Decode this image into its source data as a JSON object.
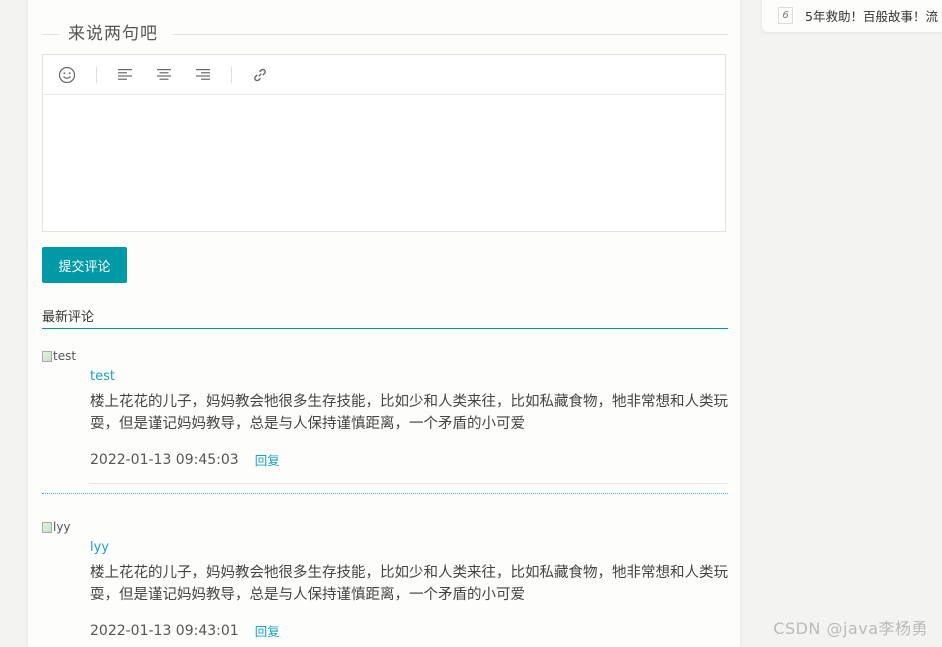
{
  "comment_form": {
    "section_title": "来说两句吧",
    "submit_label": "提交评论"
  },
  "toolbar": {
    "tools": [
      "emoji-icon",
      "align-left-icon",
      "align-center-icon",
      "align-right-icon",
      "link-icon"
    ]
  },
  "latest": {
    "title": "最新评论"
  },
  "comments": [
    {
      "avatar_alt": "test",
      "username": "test",
      "content": "楼上花花的儿子，妈妈教会牠很多生存技能，比如少和人类来往，比如私藏食物，牠非常想和人类玩耍，但是谨记妈妈教导，总是与人保持谨慎距离，一个矛盾的小可爱",
      "time": "2022-01-13 09:45:03",
      "reply_label": "回复"
    },
    {
      "avatar_alt": "lyy",
      "username": "lyy",
      "content": "楼上花花的儿子，妈妈教会牠很多生存技能，比如少和人类来往，比如私藏食物，牠非常想和人类玩耍，但是谨记妈妈教导，总是与人保持谨慎距离，一个矛盾的小可爱",
      "time": "2022-01-13 09:43:01",
      "reply_label": "回复"
    }
  ],
  "sidebar": {
    "rank": "6",
    "item_text": "5年救助！百般故事！流"
  },
  "watermark": "CSDN @java李杨勇",
  "colors": {
    "accent": "#009aa6",
    "link": "#17a2c8"
  }
}
